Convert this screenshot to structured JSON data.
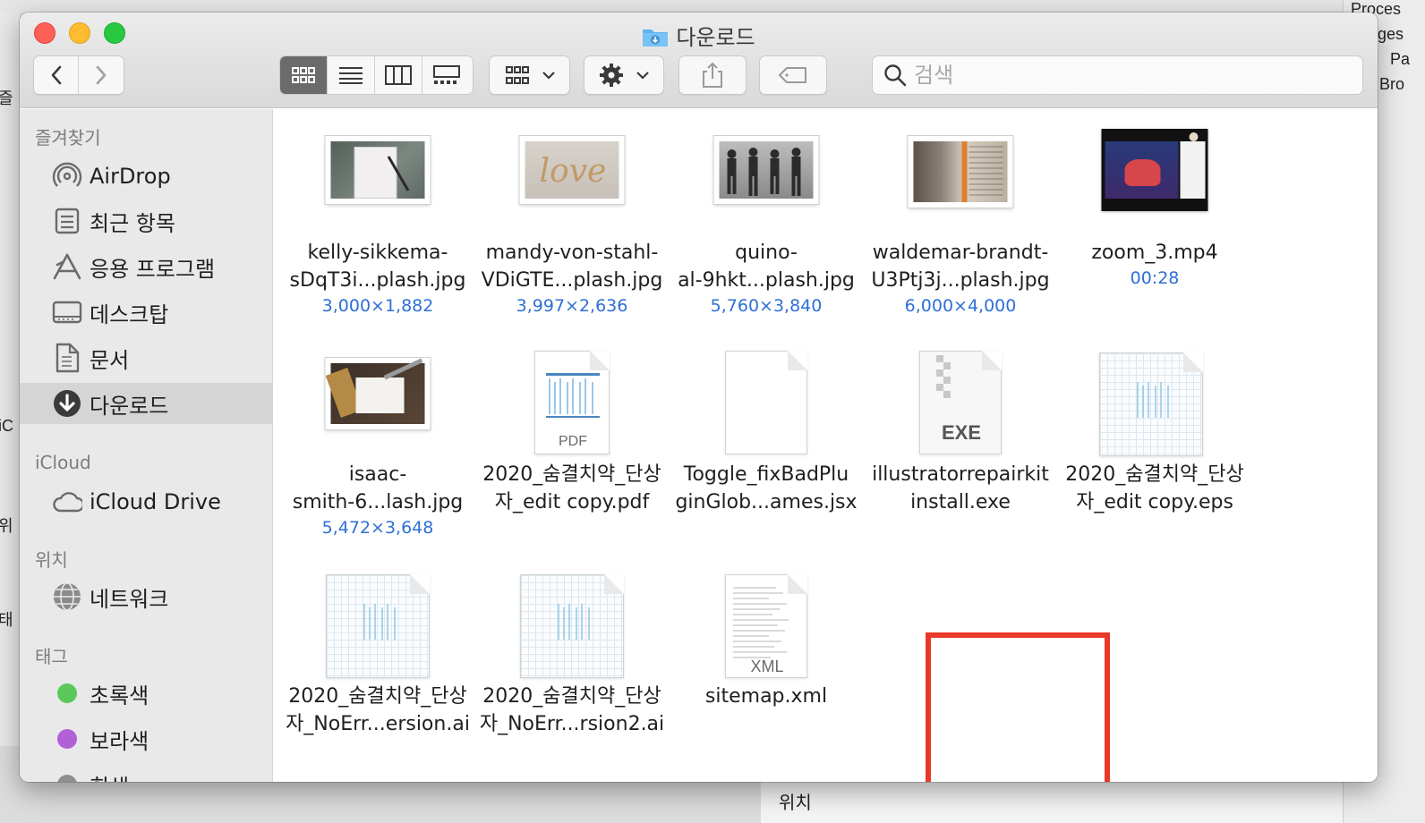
{
  "window": {
    "title": "다운로드",
    "search_placeholder": "검색"
  },
  "toolbar": {
    "back": "back",
    "forward": "forward",
    "views": [
      "icon-view",
      "list-view",
      "column-view",
      "gallery-view"
    ],
    "group_by": "group",
    "action": "action",
    "share": "share",
    "tags": "tags"
  },
  "sidebar": {
    "favorites_label": "즐겨찾기",
    "favorites": [
      {
        "label": "AirDrop",
        "icon": "airdrop-icon"
      },
      {
        "label": "최근 항목",
        "icon": "recents-icon"
      },
      {
        "label": "응용 프로그램",
        "icon": "applications-icon"
      },
      {
        "label": "데스크탑",
        "icon": "desktop-icon"
      },
      {
        "label": "문서",
        "icon": "documents-icon"
      },
      {
        "label": "다운로드",
        "icon": "downloads-icon",
        "selected": true
      }
    ],
    "icloud_label": "iCloud",
    "icloud": [
      {
        "label": "iCloud Drive",
        "icon": "cloud-icon"
      }
    ],
    "locations_label": "위치",
    "locations": [
      {
        "label": "네트워크",
        "icon": "network-icon"
      }
    ],
    "tags_label": "태그",
    "tags": [
      {
        "label": "초록색",
        "color": "#5ac85b"
      },
      {
        "label": "보라색",
        "color": "#b160d6"
      },
      {
        "label": "회색",
        "color": "#8e8e8e"
      }
    ]
  },
  "files": [
    {
      "line1": "kelly-sikkema-",
      "line2": "sDqT3i...plash.jpg",
      "meta": "3,000×1,882",
      "kind": "photo-notebook"
    },
    {
      "line1": "mandy-von-stahl-",
      "line2": "VDiGTE...plash.jpg",
      "meta": "3,997×2,636",
      "kind": "photo-love"
    },
    {
      "line1": "quino-",
      "line2": "al-9hkt...plash.jpg",
      "meta": "5,760×3,840",
      "kind": "photo-runners"
    },
    {
      "line1": "waldemar-brandt-",
      "line2": "U3Ptj3j...plash.jpg",
      "meta": "6,000×4,000",
      "kind": "photo-book"
    },
    {
      "line1": "zoom_3.mp4",
      "line2": "",
      "meta": "00:28",
      "kind": "video"
    },
    {
      "line1": "isaac-",
      "line2": "smith-6...lash.jpg",
      "meta": "5,472×3,648",
      "kind": "photo-desk"
    },
    {
      "line1": "2020_숨결치약_단상",
      "line2": "자_edit copy.pdf",
      "meta": "",
      "kind": "pdf",
      "doc_label": "PDF"
    },
    {
      "line1": "Toggle_fixBadPlu",
      "line2": "ginGlob...ames.jsx",
      "meta": "",
      "kind": "blank"
    },
    {
      "line1": "illustratorrepairkit",
      "line2": "install.exe",
      "meta": "",
      "kind": "exe",
      "doc_label": "EXE"
    },
    {
      "line1": "2020_숨결치약_단상",
      "line2": "자_edit copy.eps",
      "meta": "",
      "kind": "eps"
    },
    {
      "line1": "2020_숨결치약_단상",
      "line2": "자_NoErr...ersion.ai",
      "meta": "",
      "kind": "ai"
    },
    {
      "line1": "2020_숨결치약_단상",
      "line2": "자_NoErr...rsion2.ai",
      "meta": "",
      "kind": "ai"
    },
    {
      "line1": "sitemap.xml",
      "line2": "",
      "meta": "",
      "kind": "xml",
      "doc_label": "XML",
      "highlighted": true
    }
  ],
  "background": {
    "right_texts": [
      "Proces",
      "ges",
      "Pa",
      "Bro"
    ],
    "bottom_text": "위치",
    "left_texts": [
      "즐",
      "iC",
      "위",
      "태"
    ]
  },
  "colors": {
    "highlight": "#e8392a",
    "meta_blue": "#2f6fd6",
    "selected_bg": "#d5d5d5"
  }
}
